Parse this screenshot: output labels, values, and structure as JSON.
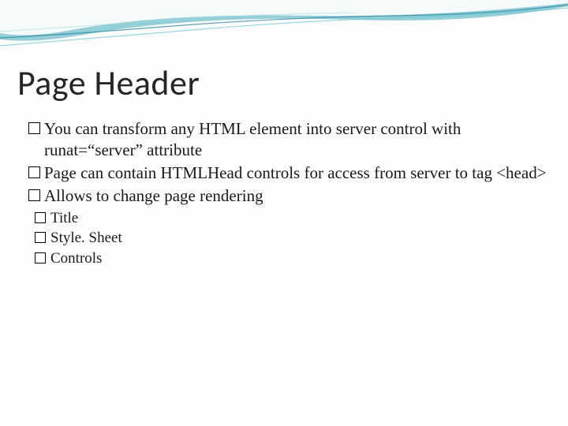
{
  "title": "Page Header",
  "bullets": [
    "You can transform any HTML element into server control with runat=“server” attribute",
    "Page can contain HTMLHead controls for access from server to tag <head>",
    "Allows to change page rendering"
  ],
  "sub_bullets": [
    "Title",
    "Style. Sheet",
    "Controls"
  ]
}
